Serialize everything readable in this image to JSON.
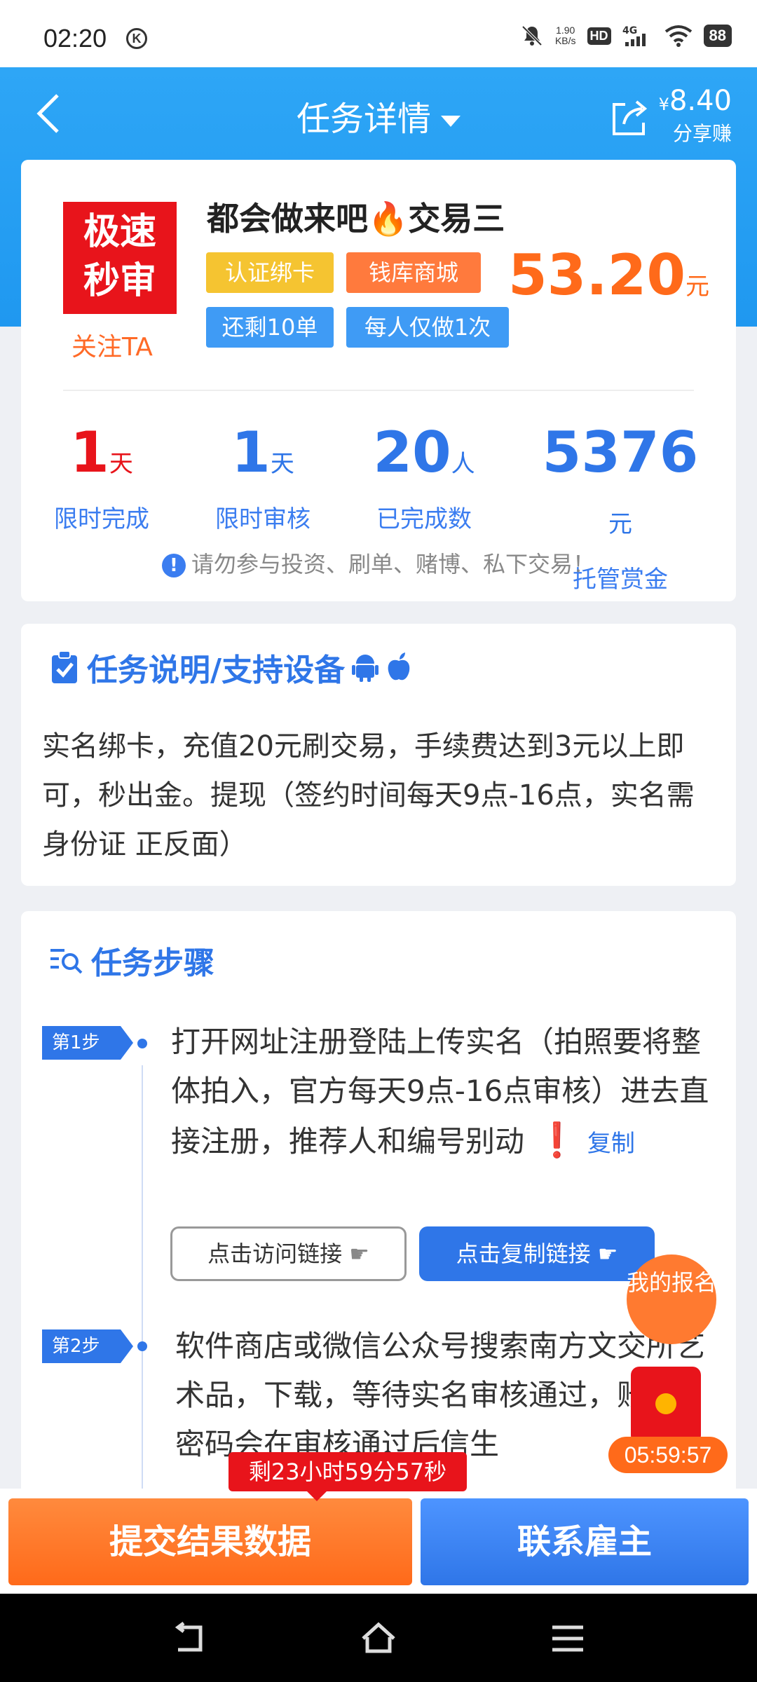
{
  "status_bar": {
    "time": "02:20",
    "speed": "1.90",
    "speed_unit": "KB/s",
    "hd": "HD",
    "network": "4G",
    "battery": "88"
  },
  "header": {
    "title": "任务详情",
    "share_amount": "8.40",
    "share_currency": "¥",
    "share_label": "分享赚"
  },
  "task": {
    "badge_line1": "极速",
    "badge_line2": "秒审",
    "follow_label": "关注TA",
    "name": "都会做来吧🔥交易三",
    "tags": [
      "认证绑卡",
      "钱库商城",
      "还剩10单",
      "每人仅做1次"
    ],
    "price": "53.20",
    "price_unit": "元"
  },
  "stats": [
    {
      "value": "1",
      "unit": "天",
      "label": "限时完成"
    },
    {
      "value": "1",
      "unit": "天",
      "label": "限时审核"
    },
    {
      "value": "20",
      "unit": "人",
      "label": "已完成数"
    },
    {
      "value": "5376",
      "unit": "元",
      "label": "托管赏金"
    }
  ],
  "warning": "请勿参与投资、刷单、赌博、私下交易！",
  "description": {
    "title": "任务说明/支持设备",
    "text": "实名绑卡，充值20元刷交易，手续费达到3元以上即可，秒出金。提现（签约时间每天9点-16点，实名需身份证 正反面）"
  },
  "steps": {
    "title": "任务步骤",
    "items": [
      {
        "badge": "第1步",
        "text": "打开网址注册登陆上传实名（拍照要将整体拍入，官方每天9点-16点审核）进去直接注册，推荐人和编号别动",
        "copy": "复制",
        "visit_btn": "点击访问链接",
        "copy_btn": "点击复制链接"
      },
      {
        "badge": "第2步",
        "text": "软件商店或微信公众号搜索南方文交所艺术品，下载，等待实名审核通过，账号，密码会在审核通过后信生"
      }
    ]
  },
  "floating": {
    "register": "我的报名",
    "timer": "05:59:57"
  },
  "countdown": "剩23小时59分57秒",
  "actions": {
    "submit": "提交结果数据",
    "contact": "联系雇主"
  },
  "colors": {
    "primary": "#2f76e8",
    "accent": "#ff6a1a",
    "header": "#1f98f0",
    "badge_red": "#e8141b"
  }
}
